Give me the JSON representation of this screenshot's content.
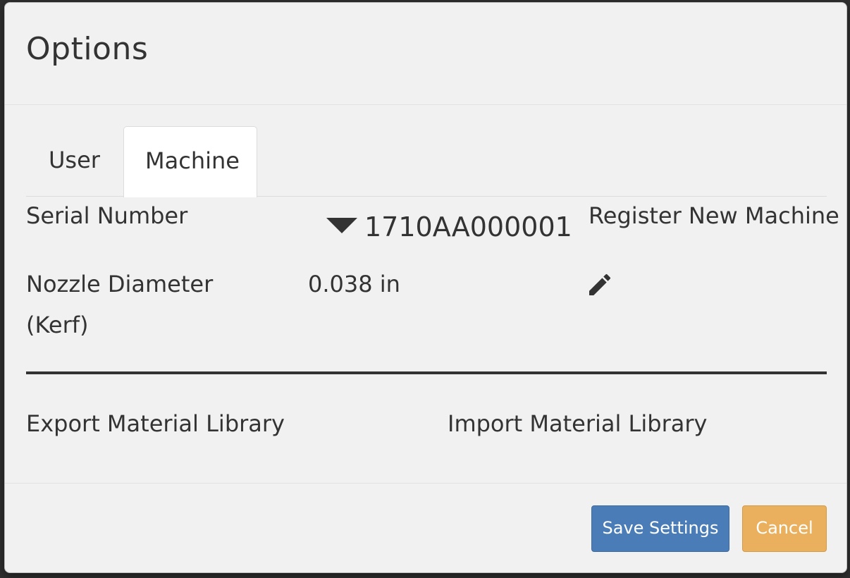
{
  "dialog": {
    "title": "Options"
  },
  "tabs": [
    {
      "label": "User",
      "active": false
    },
    {
      "label": "Machine",
      "active": true
    }
  ],
  "machine": {
    "serial_label": "Serial Number",
    "serial_value": "1710AA000001",
    "register_label": "Register New Machine",
    "nozzle_label": "Nozzle Diameter (Kerf)",
    "nozzle_value": "0.038 in",
    "edit_icon": "pencil-icon"
  },
  "library": {
    "export_label": "Export Material Library",
    "import_label": "Import Material Library"
  },
  "footer": {
    "save_label": "Save Settings",
    "cancel_label": "Cancel"
  },
  "colors": {
    "save_button": "#4a7cb7",
    "cancel_button": "#ebb05e",
    "dialog_background": "#f1f1f1"
  }
}
